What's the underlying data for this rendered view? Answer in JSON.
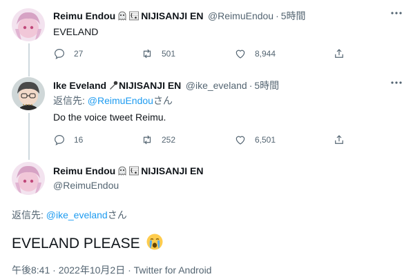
{
  "colors": {
    "link": "#1d9bf0",
    "secondary": "#536471",
    "primary_text": "#0f1419",
    "thread_line": "#cfd9de"
  },
  "tweet1": {
    "name": "Reimu Endou",
    "org": "NIJISANJI EN",
    "handle": "@ReimuEndou",
    "dot": "·",
    "time": "5時間",
    "text": "EVELAND",
    "actions": {
      "reply": "27",
      "retweet": "501",
      "like": "8,944"
    },
    "icons": [
      "reply-icon",
      "retweet-icon",
      "like-icon",
      "share-icon",
      "more-icon"
    ]
  },
  "tweet2": {
    "name": "Ike Eveland",
    "org": "NIJISANJI EN",
    "handle": "@ike_eveland",
    "dot": "·",
    "time": "5時間",
    "reply_prefix": "返信先: ",
    "reply_to": "@ReimuEndou",
    "reply_suffix": "さん",
    "text": "Do the voice tweet Reimu.",
    "actions": {
      "reply": "16",
      "retweet": "252",
      "like": "6,501"
    }
  },
  "main_tweet": {
    "name": "Reimu Endou",
    "org": "NIJISANJI EN",
    "handle": "@ReimuEndou",
    "reply_prefix": "返信先: ",
    "reply_to": "@ike_eveland",
    "reply_suffix": "さん",
    "text": "EVELAND PLEASE",
    "timestamp": "午後8:41 · 2022年10月2日 · ",
    "source": "Twitter for Android"
  }
}
